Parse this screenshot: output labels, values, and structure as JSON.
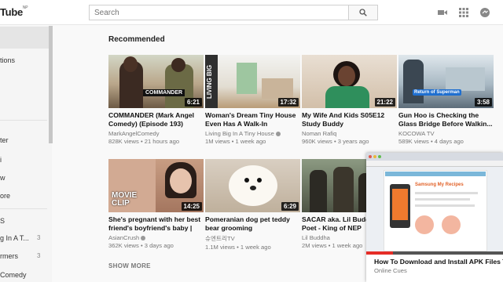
{
  "masthead": {
    "logo": "Tube",
    "logo_sup": "NP",
    "search_placeholder": "Search"
  },
  "sidebar": {
    "items": [
      {
        "label": "",
        "active": true
      },
      {
        "label": "tions"
      },
      {
        "label": "ter"
      },
      {
        "label": "i"
      },
      {
        "label": "w"
      },
      {
        "label": "ore"
      },
      {
        "label": "S"
      },
      {
        "label": "g In A T...",
        "count": "3"
      },
      {
        "label": "rmers",
        "count": "3"
      },
      {
        "label": "Comedy"
      }
    ]
  },
  "main": {
    "heading": "Recommended",
    "show_more": "SHOW MORE",
    "videos": [
      {
        "title": "COMMANDER (Mark Angel Comedy) (Episode 193)",
        "channel": "MarkAngelComedy",
        "views": "828K views",
        "age": "21 hours ago",
        "duration": "6:21",
        "thumb_caption": "COMMANDER",
        "verified": false
      },
      {
        "title": "Woman's Dream Tiny House Even Has A Walk-In Wardrobe",
        "channel": "Living Big In A Tiny House",
        "views": "1M views",
        "age": "1 week ago",
        "duration": "17:32",
        "thumb_caption": "LIVING BIG",
        "verified": true
      },
      {
        "title": "My Wife And Kids S05E12 Study Buddy",
        "channel": "Noman Rafiq",
        "views": "960K views",
        "age": "3 years ago",
        "duration": "21:22",
        "verified": false
      },
      {
        "title": "Gun Hoo is Checking the Glass Bridge Before Walkin...",
        "channel": "KOCOWA TV",
        "views": "589K views",
        "age": "4 days ago",
        "duration": "3:58",
        "thumb_caption": "Return of Superman",
        "verified": false
      },
      {
        "title": "She's pregnant with her best friend's boyfriend's baby | Cl...",
        "channel": "AsianCrush",
        "views": "362K views",
        "age": "3 days ago",
        "duration": "14:25",
        "thumb_caption": "MOVIE CLIP",
        "verified": true
      },
      {
        "title": "Pomeranian dog pet teddy bear grooming",
        "channel": "슈엔트리TV",
        "views": "1.1M views",
        "age": "1 week ago",
        "duration": "6:29",
        "verified": false
      },
      {
        "title": "SACAR aka. Lil Buddha Uniq Poet - King of NEP",
        "channel": "Lil Buddha",
        "views": "2M views",
        "age": "1 week ago",
        "duration": "",
        "verified": false
      }
    ]
  },
  "mini_player": {
    "title": "How To Download and Install APK Files To Ma",
    "channel": "Online Cues",
    "screen_heading": "Samsung My Recipes"
  }
}
